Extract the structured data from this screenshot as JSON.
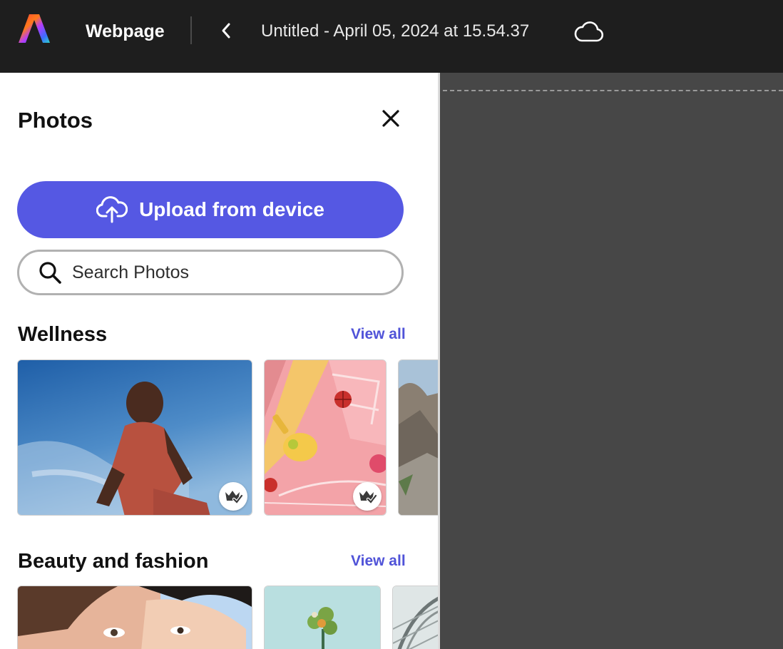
{
  "topbar": {
    "app_name": "Webpage",
    "document_title": "Untitled - April 05, 2024 at 15.54.37"
  },
  "panel": {
    "title": "Photos",
    "upload_label": "Upload from device",
    "search_placeholder": "Search Photos",
    "sections": [
      {
        "title": "Wellness",
        "view_all": "View all"
      },
      {
        "title": "Beauty and fashion",
        "view_all": "View all"
      }
    ]
  },
  "colors": {
    "accent": "#5558e3",
    "link": "#5053d8",
    "topbar_bg": "#1e1e1e",
    "canvas_bg": "#474747"
  }
}
